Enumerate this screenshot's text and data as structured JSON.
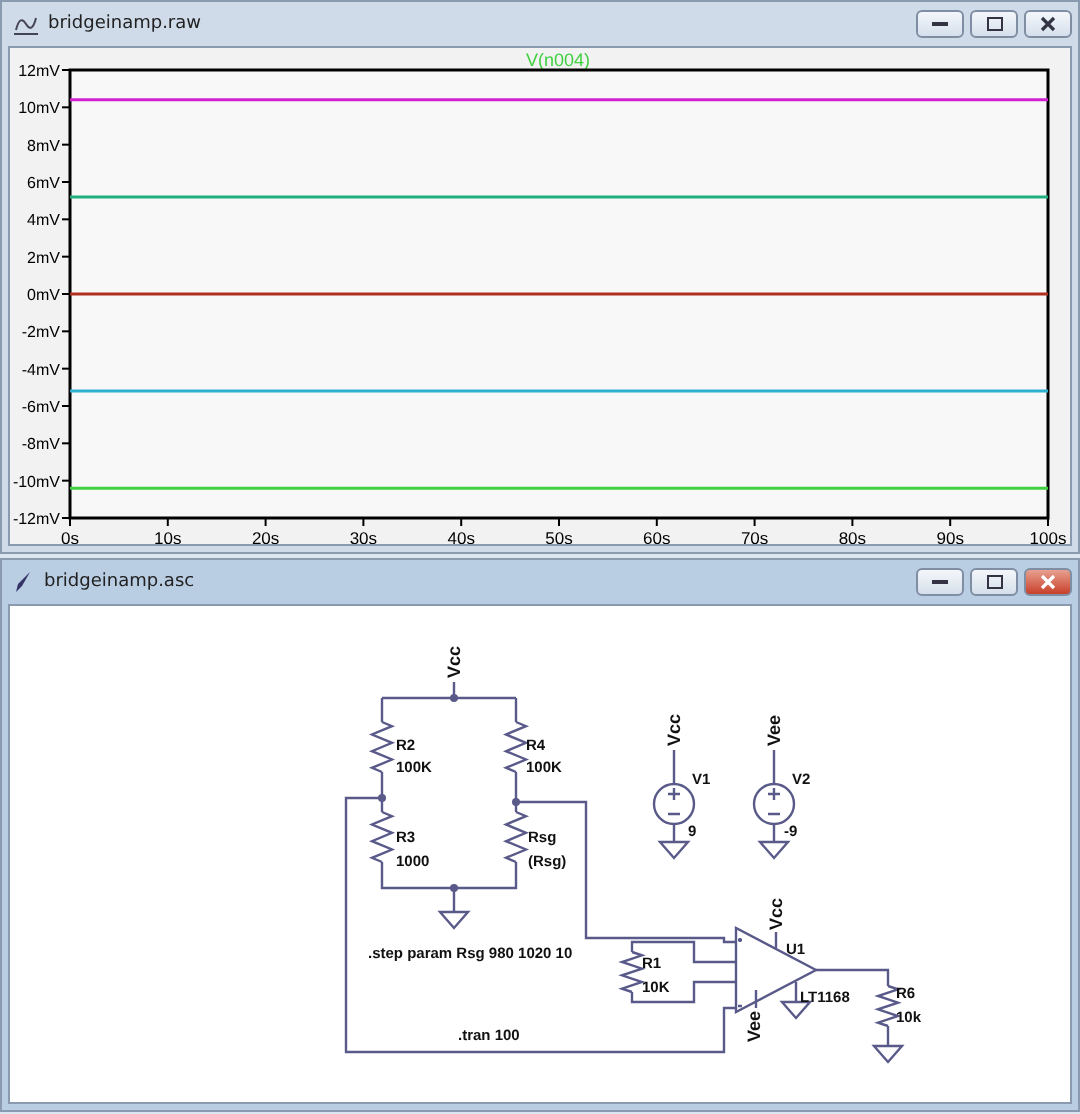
{
  "plot_window": {
    "title": "bridgeinamp.raw",
    "chart_data": {
      "type": "line",
      "title": "V(n004)",
      "x": [
        0,
        100
      ],
      "series": [
        {
          "color": "#d020d0",
          "values": [
            10.4,
            10.4
          ]
        },
        {
          "color": "#20b080",
          "values": [
            5.2,
            5.2
          ]
        },
        {
          "color": "#b03020",
          "values": [
            0,
            0
          ]
        },
        {
          "color": "#30b0d0",
          "values": [
            -5.2,
            -5.2
          ]
        },
        {
          "color": "#40d040",
          "values": [
            -10.4,
            -10.4
          ]
        }
      ],
      "xlim": [
        0,
        100
      ],
      "ylim": [
        -12,
        12
      ],
      "xticks": [
        {
          "value": 0,
          "label": "0s"
        },
        {
          "value": 10,
          "label": "10s"
        },
        {
          "value": 20,
          "label": "20s"
        },
        {
          "value": 30,
          "label": "30s"
        },
        {
          "value": 40,
          "label": "40s"
        },
        {
          "value": 50,
          "label": "50s"
        },
        {
          "value": 60,
          "label": "60s"
        },
        {
          "value": 70,
          "label": "70s"
        },
        {
          "value": 80,
          "label": "80s"
        },
        {
          "value": 90,
          "label": "90s"
        },
        {
          "value": 100,
          "label": "100s"
        }
      ],
      "yticks": [
        {
          "value": 12,
          "label": "12mV"
        },
        {
          "value": 10,
          "label": "10mV"
        },
        {
          "value": 8,
          "label": "8mV"
        },
        {
          "value": 6,
          "label": "6mV"
        },
        {
          "value": 4,
          "label": "4mV"
        },
        {
          "value": 2,
          "label": "2mV"
        },
        {
          "value": 0,
          "label": "0mV"
        },
        {
          "value": -2,
          "label": "-2mV"
        },
        {
          "value": -4,
          "label": "-4mV"
        },
        {
          "value": -6,
          "label": "-6mV"
        },
        {
          "value": -8,
          "label": "-8mV"
        },
        {
          "value": -10,
          "label": "-10mV"
        },
        {
          "value": -12,
          "label": "-12mV"
        }
      ]
    }
  },
  "schematic_window": {
    "title": "bridgeinamp.asc",
    "active": true,
    "labels": [
      {
        "kind": "net",
        "text": "Vcc"
      },
      {
        "kind": "part",
        "text": "R2"
      },
      {
        "kind": "part",
        "text": "100K"
      },
      {
        "kind": "part",
        "text": "R4"
      },
      {
        "kind": "part",
        "text": "100K"
      },
      {
        "kind": "part",
        "text": "R3"
      },
      {
        "kind": "part",
        "text": "1000"
      },
      {
        "kind": "part",
        "text": "Rsg"
      },
      {
        "kind": "part",
        "text": "(Rsg)"
      },
      {
        "kind": "net",
        "text": "Vcc"
      },
      {
        "kind": "part",
        "text": "V1"
      },
      {
        "kind": "part",
        "text": "9"
      },
      {
        "kind": "net",
        "text": "Vee"
      },
      {
        "kind": "part",
        "text": "V2"
      },
      {
        "kind": "part",
        "text": "-9"
      },
      {
        "kind": "directive",
        "text": ".step param Rsg 980 1020 10"
      },
      {
        "kind": "net",
        "text": "Vcc"
      },
      {
        "kind": "part",
        "text": "U1"
      },
      {
        "kind": "part",
        "text": "R1"
      },
      {
        "kind": "part",
        "text": "10K"
      },
      {
        "kind": "part",
        "text": "LT1168"
      },
      {
        "kind": "net",
        "text": "Vee"
      },
      {
        "kind": "part",
        "text": "R6"
      },
      {
        "kind": "part",
        "text": "10k"
      },
      {
        "kind": "directive",
        "text": ".tran 100"
      }
    ]
  }
}
